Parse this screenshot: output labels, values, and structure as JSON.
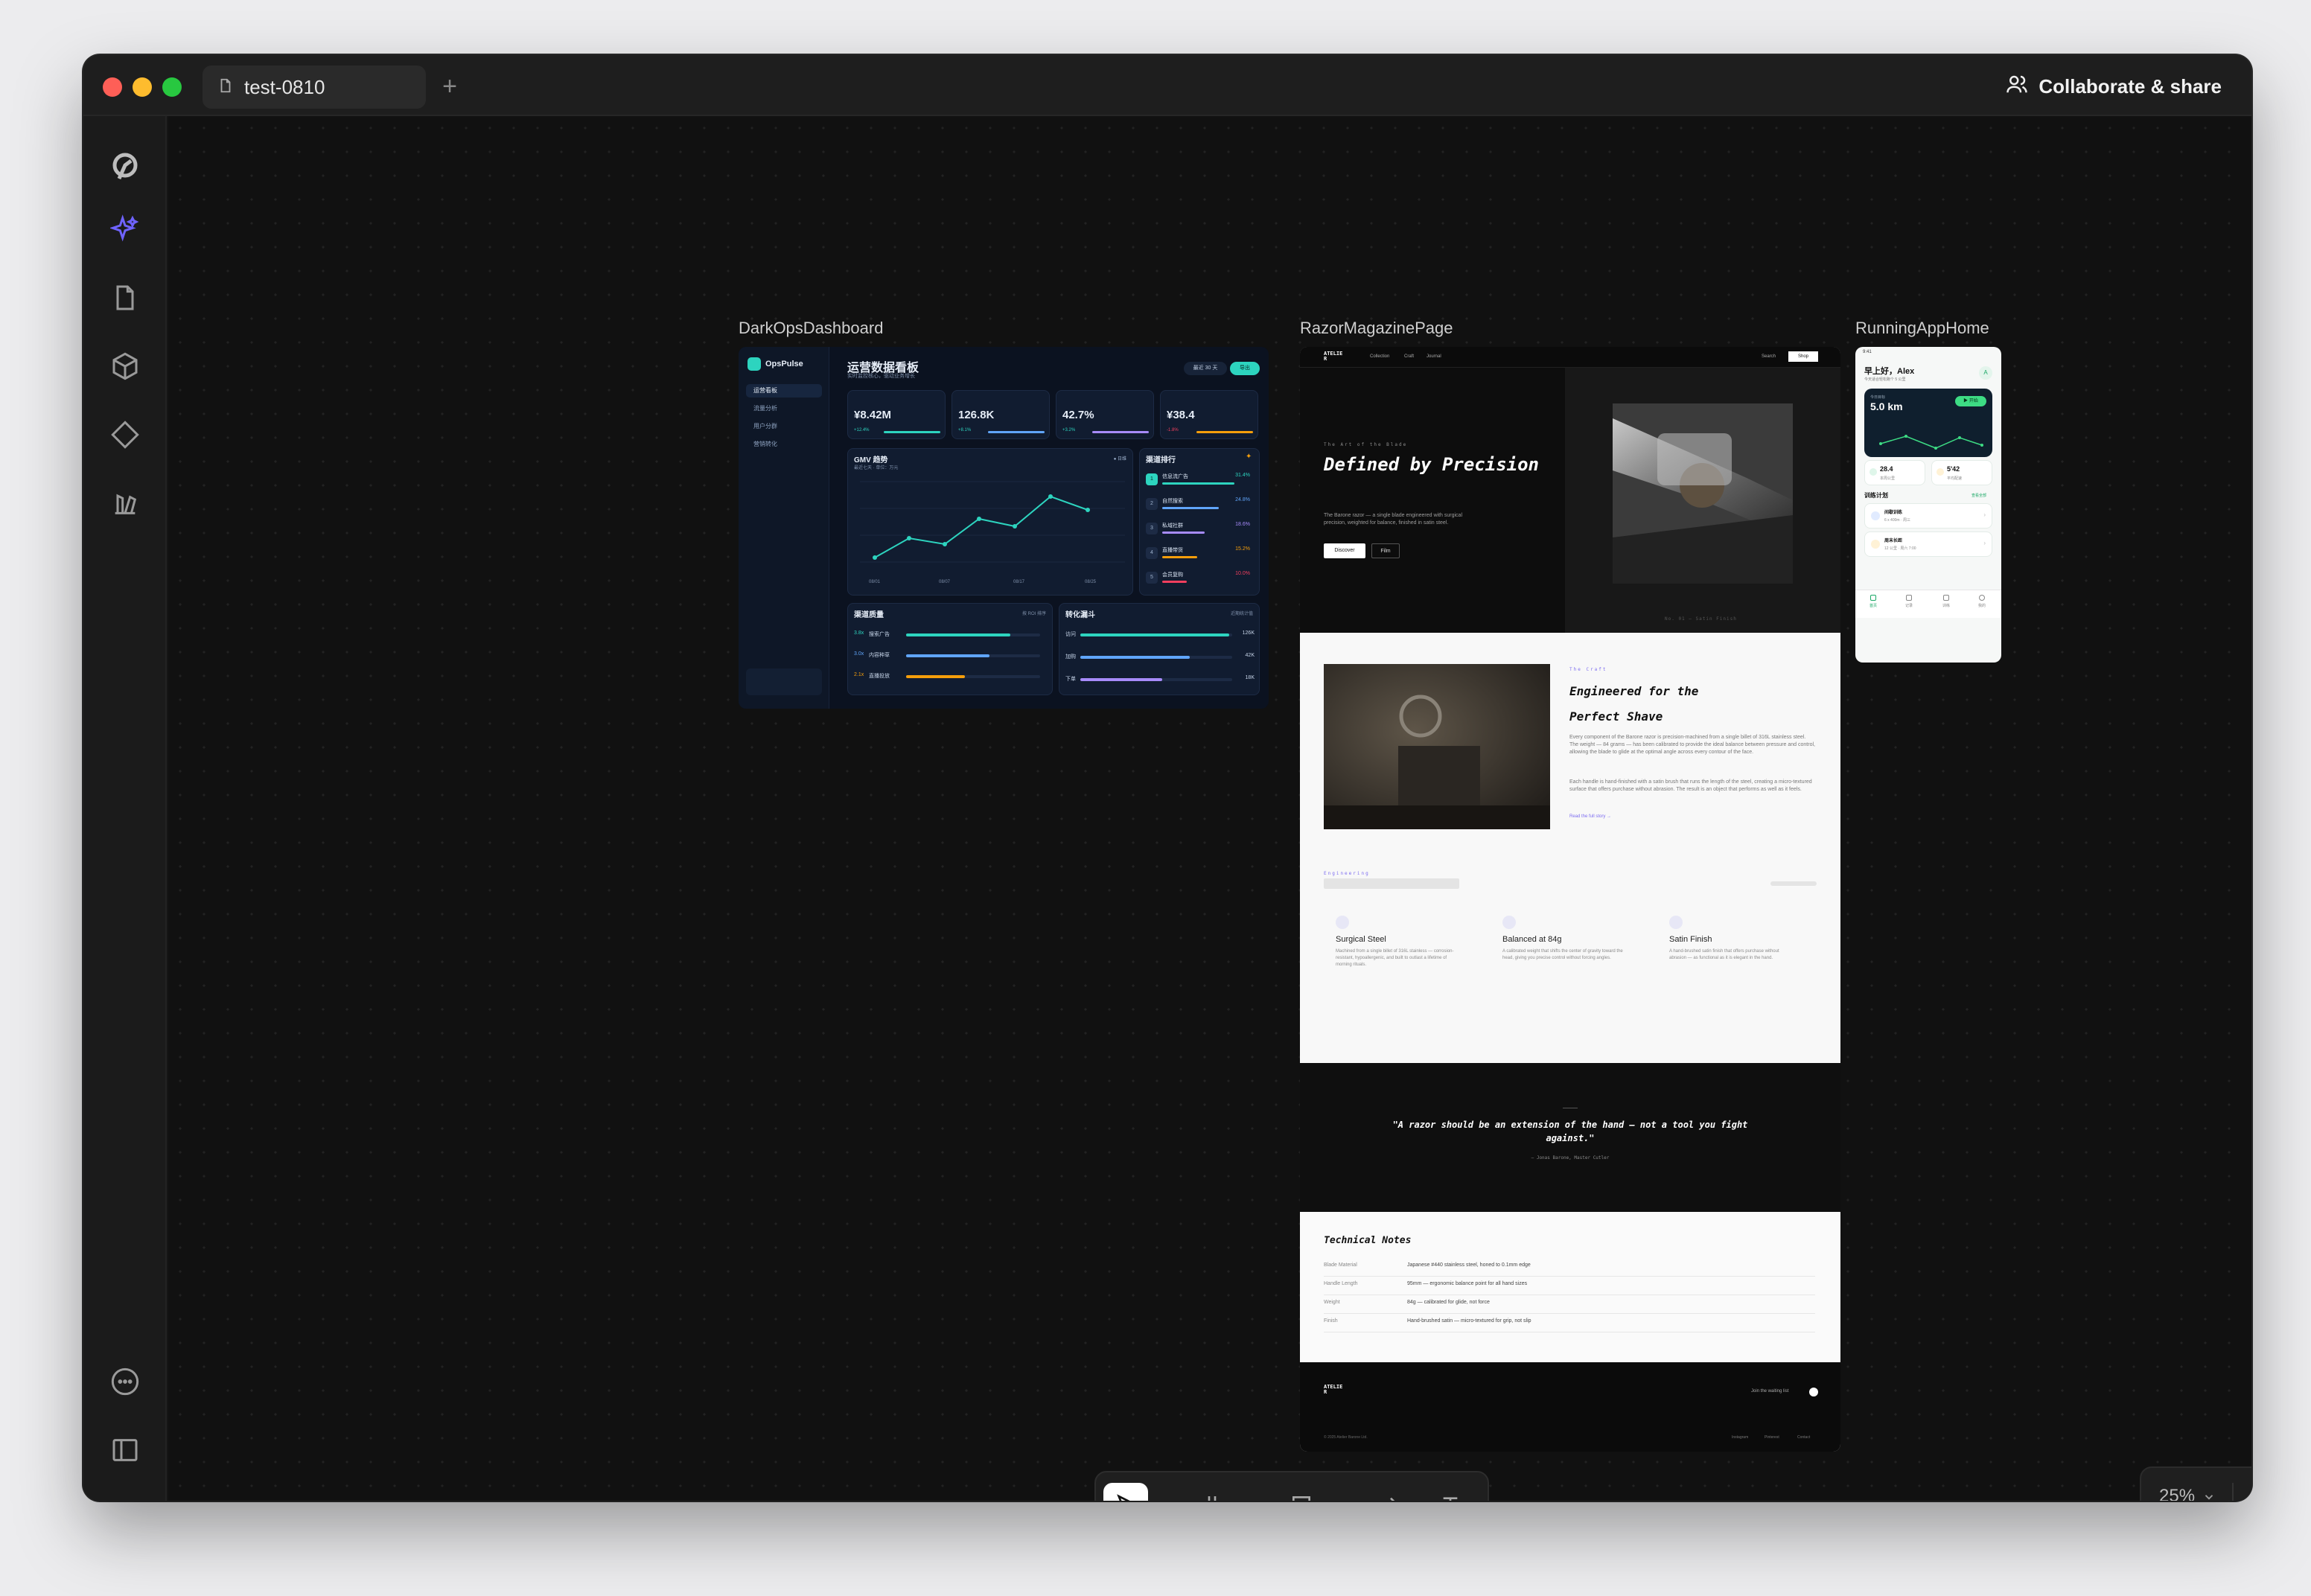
{
  "app": {
    "tab_title": "test-0810",
    "tab_add": "+",
    "share_label": "Collaborate & share",
    "zoom_level": "25%"
  },
  "frames": {
    "dashboard": {
      "label": "DarkOpsDashboard"
    },
    "magazine": {
      "label": "RazorMagazinePage"
    },
    "running": {
      "label": "RunningAppHome"
    }
  },
  "dashboard": {
    "brand": "OpsPulse",
    "title": "运营数据看板",
    "subtitle": "实时监控核心，驱动业务增长",
    "nav": [
      "运营看板",
      "流量分析",
      "用户分群",
      "营销转化"
    ],
    "date_pill": "最近 30 天",
    "export_pill": "导出",
    "kpis": [
      {
        "value": "¥8.42M",
        "delta": "+12.4%"
      },
      {
        "value": "126.8K",
        "delta": "+8.1%"
      },
      {
        "value": "42.7%",
        "delta": "+3.2%"
      },
      {
        "value": "¥38.4",
        "delta": "-1.8%"
      }
    ],
    "chart": {
      "title": "GMV 趋势",
      "subtitle": "最近七天 · 单位：万元",
      "tag": "● 日维",
      "x_labels": [
        "08/01",
        "08/07",
        "08/17",
        "08/25"
      ]
    },
    "ranking": {
      "title": "渠道排行",
      "rows": [
        {
          "label": "信息流广告",
          "value": "31.4%",
          "fill": 0.82,
          "color": "#2dd4bf"
        },
        {
          "label": "自然搜索",
          "value": "24.8%",
          "fill": 0.64,
          "color": "#60a5fa"
        },
        {
          "label": "私域社群",
          "value": "18.6%",
          "fill": 0.48,
          "color": "#a78bfa"
        },
        {
          "label": "直播带货",
          "value": "15.2%",
          "fill": 0.4,
          "color": "#f59e0b"
        },
        {
          "label": "会员复购",
          "value": "10.0%",
          "fill": 0.28,
          "color": "#f43f5e"
        }
      ]
    },
    "quality": {
      "title": "渠道质量",
      "tag": "按 ROI 排序",
      "rows": [
        {
          "badge": "3.8x",
          "label": "搜索广告",
          "fill": 0.78,
          "color": "#2dd4bf"
        },
        {
          "badge": "3.0x",
          "label": "内容种草",
          "fill": 0.62,
          "color": "#60a5fa"
        },
        {
          "badge": "2.1x",
          "label": "直播投放",
          "fill": 0.44,
          "color": "#f59e0b"
        }
      ]
    },
    "funnel": {
      "title": "转化漏斗",
      "tag": "近期统计值",
      "rows": [
        {
          "label": "访问",
          "value": "126K",
          "fill": 0.98,
          "color": "#2dd4bf"
        },
        {
          "label": "加购",
          "value": "42K",
          "fill": 0.72,
          "color": "#60a5fa"
        },
        {
          "label": "下单",
          "value": "18K",
          "fill": 0.54,
          "color": "#a78bfa"
        }
      ]
    }
  },
  "magazine": {
    "logo": "ATELIE R",
    "nav": [
      "Collection",
      "Craft",
      "Journal"
    ],
    "nav_search": "Search",
    "nav_cta": "Shop",
    "kicker": "The Art of the Blade",
    "headline": "Defined by Precision",
    "intro": "The Barone razor — a single blade engineered with surgical precision, weighted for balance, finished in satin steel.",
    "btn_primary": "Discover",
    "btn_secondary": "Film",
    "hero_caption": "No. 01 — Satin Finish",
    "craft_kicker": "The Craft",
    "craft_title": "Engineered for the Perfect Shave",
    "craft_body_1": "Every component of the Barone razor is precision-machined from a single billet of 316L stainless steel. The weight — 84 grams — has been calibrated to provide the ideal balance between pressure and control, allowing the blade to glide at the optimal angle across every contour of the face.",
    "craft_body_2": "Each handle is hand-finished with a satin brush that runs the length of the steel, creating a micro-textured surface that offers purchase without abrasion. The result is an object that performs as well as it feels.",
    "craft_link": "Read the full story →",
    "eng_kicker": "Engineering",
    "features": [
      {
        "title": "Surgical Steel",
        "desc": "Machined from a single billet of 316L stainless — corrosion-resistant, hypoallergenic, and built to outlast a lifetime of morning rituals."
      },
      {
        "title": "Balanced at 84g",
        "desc": "A calibrated weight that shifts the center of gravity toward the head, giving you precise control without forcing angles."
      },
      {
        "title": "Satin Finish",
        "desc": "A hand-brushed satin finish that offers purchase without abrasion — as functional as it is elegant in the hand."
      }
    ],
    "quote": "\"A razor should be an extension of the hand — not a tool you fight against.\"",
    "quote_attr": "— Jonas Barone, Master Cutler",
    "notes_title": "Technical Notes",
    "notes": [
      {
        "key": "Blade Material",
        "value": "Japanese #440 stainless steel, honed to 0.1mm edge"
      },
      {
        "key": "Handle Length",
        "value": "95mm — ergonomic balance point for all hand sizes"
      },
      {
        "key": "Weight",
        "value": "84g — calibrated for glide, not force"
      },
      {
        "key": "Finish",
        "value": "Hand-brushed satin — micro-textured for grip, not slip"
      }
    ],
    "footer_logo": "ATELIE R",
    "footer_cta": "Join the waiting list",
    "footer_copy": "© 2025 Atelier Barone Ltd.",
    "footer_links": [
      "Instagram",
      "Pinterest",
      "Contact"
    ]
  },
  "running": {
    "status_time": "9:41",
    "greeting": "早上好，Alex",
    "greeting_sub": "今天适合轻松跑个 5 公里",
    "today_label": "今日目标",
    "distance": "5.0 km",
    "start_label": "▶ 开始",
    "stats": [
      {
        "value": "28.4",
        "label": "本周公里"
      },
      {
        "value": "5'42",
        "label": "平均配速"
      }
    ],
    "plan_title": "训练计划",
    "plan_link": "查看全部",
    "plans": [
      {
        "title": "间歇训练",
        "sub": "6 x 400m · 周三"
      },
      {
        "title": "周末长距",
        "sub": "12 公里 · 周六 7:00"
      }
    ],
    "tabs": [
      "首页",
      "记录",
      "训练",
      "我的"
    ]
  }
}
